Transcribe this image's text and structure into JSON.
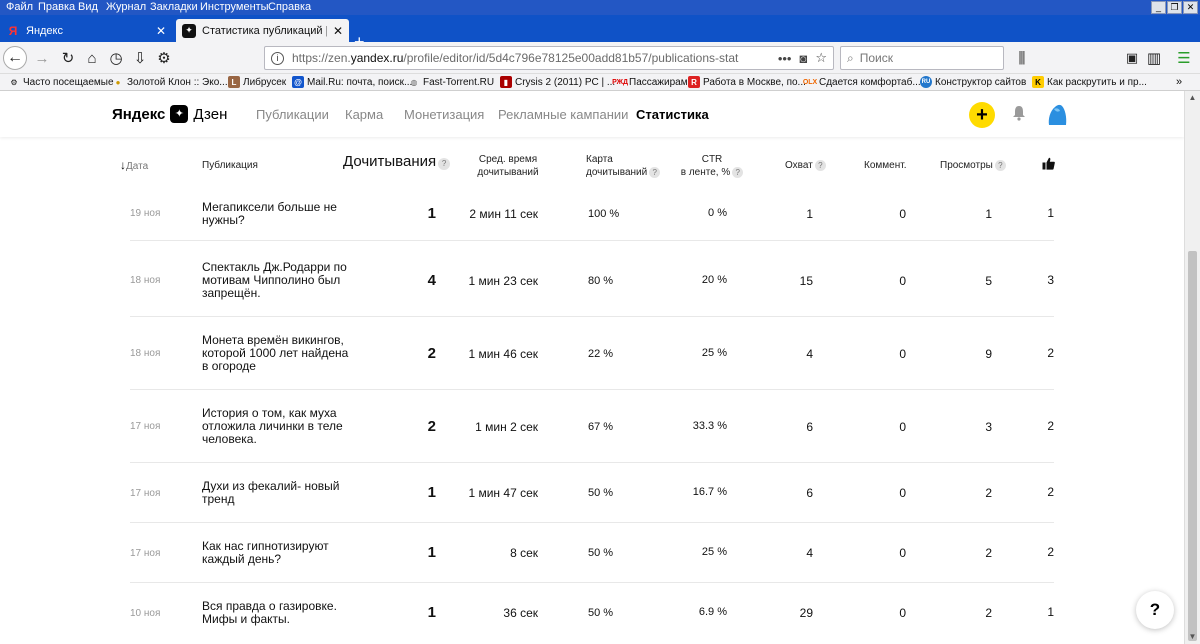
{
  "menu": [
    "Файл",
    "Правка",
    "Вид",
    "Журнал",
    "Закладки",
    "Инструменты",
    "Справка"
  ],
  "tabs": [
    {
      "title": "Яндекс",
      "favicon": "Я"
    },
    {
      "title": "Статистика публикаций | Янде",
      "favicon": "✦"
    }
  ],
  "url": {
    "prefix": "https://zen.",
    "domain": "yandex.ru",
    "path": "/profile/editor/id/5d4c796e78125e00add81b57/publications-stat"
  },
  "search_placeholder": "Поиск",
  "bookmarks": [
    {
      "label": "Часто посещаемые",
      "icon": "gear-icon"
    },
    {
      "label": "Золотой Клон :: Эко...",
      "icon": "coin-icon"
    },
    {
      "label": "Либрусек",
      "icon": "book-icon"
    },
    {
      "label": "Mail.Ru: почта, поиск...",
      "icon": "mail-icon"
    },
    {
      "label": "Fast-Torrent.RU",
      "icon": "globe-icon"
    },
    {
      "label": "Crysis 2 (2011) PC | ...",
      "icon": "game-icon"
    },
    {
      "label": "Пассажирам",
      "icon": "train-icon"
    },
    {
      "label": "Работа в Москве, по...",
      "icon": "job-icon"
    },
    {
      "label": "Сдается комфортаб...",
      "icon": "avito-icon"
    },
    {
      "label": "Конструктор сайтов",
      "icon": "ru-icon"
    },
    {
      "label": "Как раскрутить и пр...",
      "icon": "k-icon"
    }
  ],
  "zen": {
    "logo_text": "Яндекс",
    "logo_brand": "Дзен",
    "nav": [
      "Публикации",
      "Карма",
      "Монетизация",
      "Рекламные кампании",
      "Статистика"
    ]
  },
  "table": {
    "headers": {
      "date": "Дата",
      "publication": "Публикация",
      "reads": "Дочитывания",
      "avg_time_1": "Сред. время",
      "avg_time_2": "дочитываний",
      "map_1": "Карта",
      "map_2": "дочитываний",
      "ctr_1": "CTR",
      "ctr_2": "в ленте, %",
      "reach": "Охват",
      "comments": "Коммент.",
      "views": "Просмотры"
    },
    "rows": [
      {
        "date": "19 ноя",
        "title": "Мегапиксели больше не нужны?",
        "reads": "1",
        "time": "2 мин 11 сек",
        "map": "100 %",
        "ctr": "0 %",
        "reach": "1",
        "comments": "0",
        "views": "1",
        "likes": "1"
      },
      {
        "date": "18 ноя",
        "title": "Спектакль Дж.Родарри по мотивам Чипполино был запрещён.",
        "reads": "4",
        "time": "1 мин 23 сек",
        "map": "80 %",
        "ctr": "20 %",
        "reach": "15",
        "comments": "0",
        "views": "5",
        "likes": "3"
      },
      {
        "date": "18 ноя",
        "title": "Монета времён викингов, которой 1000 лет найдена в огороде",
        "reads": "2",
        "time": "1 мин 46 сек",
        "map": "22 %",
        "ctr": "25 %",
        "reach": "4",
        "comments": "0",
        "views": "9",
        "likes": "2"
      },
      {
        "date": "17 ноя",
        "title": "История о том, как муха отложила личинки в теле человека.",
        "reads": "2",
        "time": "1 мин 2 сек",
        "map": "67 %",
        "ctr": "33.3 %",
        "reach": "6",
        "comments": "0",
        "views": "3",
        "likes": "2"
      },
      {
        "date": "17 ноя",
        "title": "Духи из фекалий- новый тренд",
        "reads": "1",
        "time": "1 мин 47 сек",
        "map": "50 %",
        "ctr": "16.7 %",
        "reach": "6",
        "comments": "0",
        "views": "2",
        "likes": "2"
      },
      {
        "date": "17 ноя",
        "title": "Как нас гипнотизируют каждый день?",
        "reads": "1",
        "time": "8 сек",
        "map": "50 %",
        "ctr": "25 %",
        "reach": "4",
        "comments": "0",
        "views": "2",
        "likes": "2"
      },
      {
        "date": "10 ноя",
        "title": "Вся правда о газировке. Мифы и факты.",
        "reads": "1",
        "time": "36 сек",
        "map": "50 %",
        "ctr": "6.9 %",
        "reach": "29",
        "comments": "0",
        "views": "2",
        "likes": "1"
      }
    ]
  },
  "help_label": "?",
  "colors": {
    "menubar": "#2357c4",
    "tabstrip": "#0f52c7",
    "accent_yellow": "#ffdb00",
    "avatar_blue": "#2b8fe0"
  }
}
